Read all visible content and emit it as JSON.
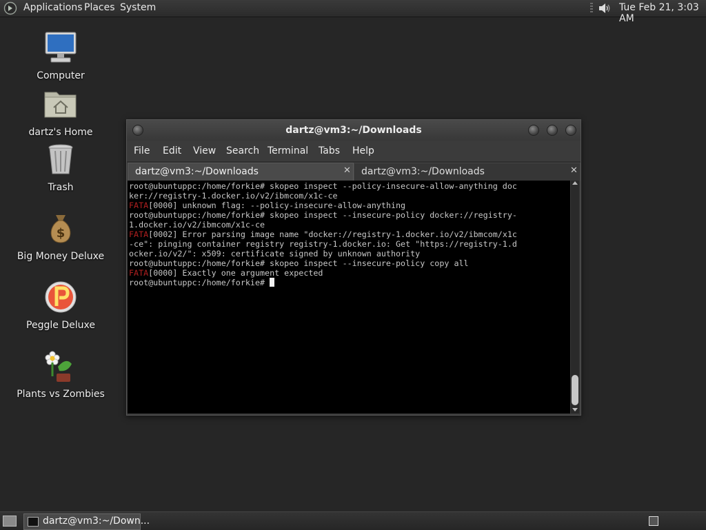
{
  "top_panel": {
    "menus": [
      "Applications",
      "Places",
      "System"
    ],
    "clock": "Tue Feb 21,  3:03 AM",
    "icons": {
      "logo": "gnome-foot-icon",
      "volume": "speaker-volume-icon"
    }
  },
  "desktop": {
    "icons": [
      {
        "label": "Computer",
        "icon": "computer-monitor-icon"
      },
      {
        "label": "dartz's Home",
        "icon": "home-folder-icon"
      },
      {
        "label": "Trash",
        "icon": "trash-can-icon"
      },
      {
        "label": "Big Money Deluxe",
        "icon": "money-bag-icon"
      },
      {
        "label": "Peggle Deluxe",
        "icon": "peggle-ball-icon"
      },
      {
        "label": "Plants vs Zombies",
        "icon": "flower-plant-icon"
      }
    ]
  },
  "terminal": {
    "title": "dartz@vm3:~/Downloads",
    "menu": [
      "File",
      "Edit",
      "View",
      "Search",
      "Terminal",
      "Tabs",
      "Help"
    ],
    "tabs": [
      {
        "label": "dartz@vm3:~/Downloads",
        "active": true
      },
      {
        "label": "dartz@vm3:~/Downloads",
        "active": false
      }
    ],
    "lines": [
      {
        "text": "root@ubuntuppc:/home/forkie# skopeo inspect --policy-insecure-allow-anything doc"
      },
      {
        "text": "ker://registry-1.docker.io/v2/ibmcom/x1c-ce"
      },
      {
        "tag": "FATA",
        "text": "[0000] unknown flag: --policy-insecure-allow-anything"
      },
      {
        "text": "root@ubuntuppc:/home/forkie# skopeo inspect --insecure-policy docker://registry-"
      },
      {
        "text": "1.docker.io/v2/ibmcom/x1c-ce"
      },
      {
        "tag": "FATA",
        "text": "[0002] Error parsing image name \"docker://registry-1.docker.io/v2/ibmcom/x1c"
      },
      {
        "text": "-ce\": pinging container registry registry-1.docker.io: Get \"https://registry-1.d"
      },
      {
        "text": "ocker.io/v2/\": x509: certificate signed by unknown authority"
      },
      {
        "text": "root@ubuntuppc:/home/forkie# skopeo inspect --insecure-policy copy all"
      },
      {
        "tag": "FATA",
        "text": "[0000] Exactly one argument expected"
      },
      {
        "text": "root@ubuntuppc:/home/forkie# ",
        "cursor": true
      }
    ],
    "colors": {
      "fata": "#b02020",
      "text": "#c8c8c8",
      "background": "#000000"
    }
  },
  "bottom_panel": {
    "task_label": "dartz@vm3:~/Down...",
    "icons": {
      "show_desktop": "show-desktop-icon",
      "workspace": "workspace-switcher-icon"
    }
  }
}
